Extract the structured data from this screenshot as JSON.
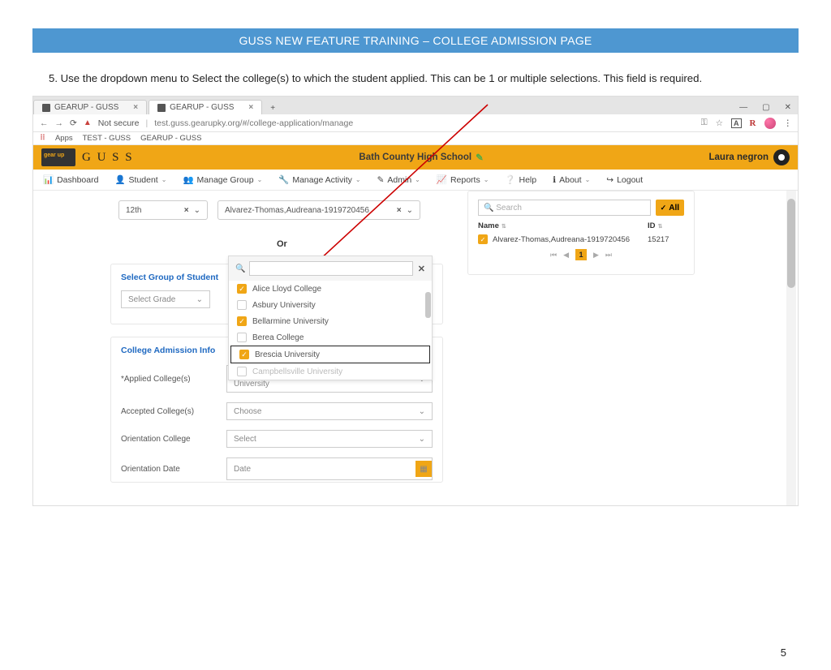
{
  "doc": {
    "header": "GUSS NEW FEATURE TRAINING – COLLEGE ADMISSION PAGE",
    "instruction": "5. Use the dropdown menu to Select the college(s) to which the student applied. This can be 1 or multiple selections. This field is  required.",
    "page_number": "5"
  },
  "browser": {
    "tabs": [
      {
        "title": "GEARUP - GUSS",
        "active": false
      },
      {
        "title": "GEARUP - GUSS",
        "active": true
      }
    ],
    "security_label": "Not secure",
    "url": "test.guss.gearupky.org/#/college-application/manage",
    "bookmarks": {
      "apps": "Apps",
      "b1": "TEST - GUSS",
      "b2": "GEARUP - GUSS"
    },
    "window": {
      "min": "—",
      "max": "▢",
      "close": "✕"
    }
  },
  "app": {
    "brand": "G U S S",
    "school": "Bath County High School",
    "user": "Laura negron",
    "nav": {
      "dashboard": "Dashboard",
      "student": "Student",
      "manage_group": "Manage Group",
      "manage_activity": "Manage Activity",
      "admin": "Admin",
      "reports": "Reports",
      "help": "Help",
      "about": "About",
      "logout": "Logout"
    }
  },
  "selectors": {
    "grade": "12th",
    "student": "Alvarez-Thomas,Audreana-1919720456",
    "or": "Or"
  },
  "group_card": {
    "title": "Select Group of Student",
    "select_grade": "Select Grade"
  },
  "info_card": {
    "title": "College Admission Info",
    "applied_label": "*Applied College(s)",
    "applied_value": "Alice Lloyd College, Bellarmine University, Brescia University",
    "accepted_label": "Accepted College(s)",
    "accepted_value": "Choose",
    "orientation_college_label": "Orientation College",
    "orientation_college_value": "Select",
    "orientation_date_label": "Orientation Date",
    "orientation_date_value": "Date"
  },
  "dropdown": {
    "options": [
      {
        "label": "Alice Lloyd College",
        "checked": true
      },
      {
        "label": "Asbury University",
        "checked": false
      },
      {
        "label": "Bellarmine University",
        "checked": true
      },
      {
        "label": "Berea College",
        "checked": false
      },
      {
        "label": "Brescia University",
        "checked": true,
        "highlight": true
      },
      {
        "label": "Campbellsville University",
        "checked": false,
        "partial": true
      }
    ]
  },
  "right_panel": {
    "search_placeholder": "Search",
    "all": "All",
    "col_name": "Name",
    "col_id": "ID",
    "row_name": "Alvarez-Thomas,Audreana-1919720456",
    "row_id": "15217",
    "page": "1"
  }
}
